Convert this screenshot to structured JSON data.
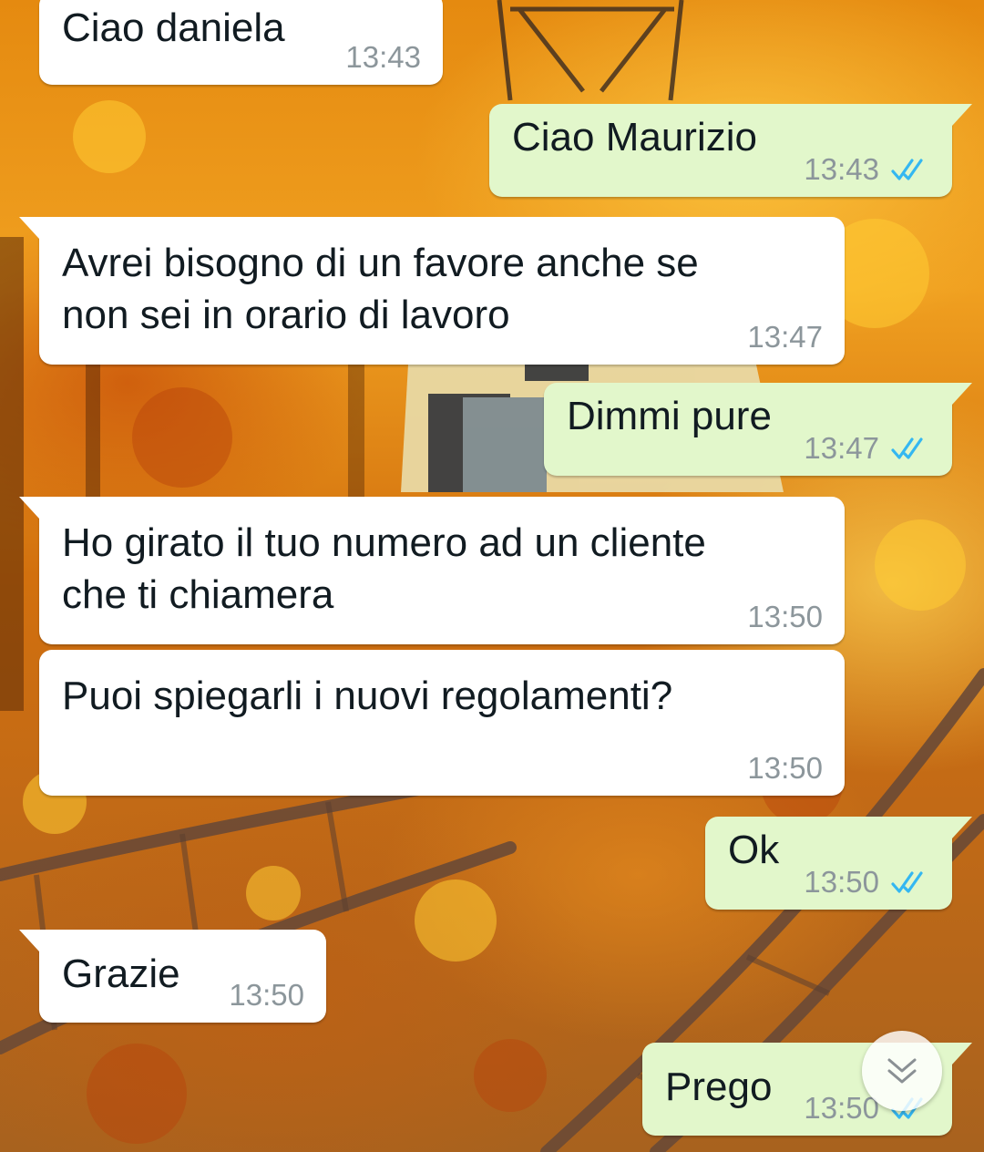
{
  "messages": [
    {
      "direction": "incoming",
      "text": "Ciao daniela",
      "time": "13:43"
    },
    {
      "direction": "outgoing",
      "text": "Ciao Maurizio",
      "time": "13:43",
      "status": "read"
    },
    {
      "direction": "incoming",
      "lines": [
        "Avrei bisogno di un favore anche se",
        "non sei in orario di lavoro"
      ],
      "time": "13:47"
    },
    {
      "direction": "outgoing",
      "text": "Dimmi pure",
      "time": "13:47",
      "status": "read"
    },
    {
      "direction": "incoming",
      "lines": [
        "Ho girato il tuo numero ad un cliente",
        "che ti chiamera"
      ],
      "time": "13:50"
    },
    {
      "direction": "incoming",
      "text": "Puoi spiegarli i nuovi regolamenti?",
      "time": "13:50"
    },
    {
      "direction": "outgoing",
      "text": "Ok",
      "time": "13:50",
      "status": "read"
    },
    {
      "direction": "incoming",
      "text": "Grazie",
      "time": "13:50"
    },
    {
      "direction": "outgoing",
      "text": "Prego",
      "time": "13:50",
      "status": "read"
    }
  ],
  "icons": {
    "read_receipt": "double-check-icon",
    "scroll_down": "double-chevron-down-icon"
  },
  "colors": {
    "incoming_bubble": "#ffffff",
    "outgoing_bubble": "#e2f7cb",
    "timestamp": "#8c969b",
    "read_ticks": "#34b7f1"
  }
}
